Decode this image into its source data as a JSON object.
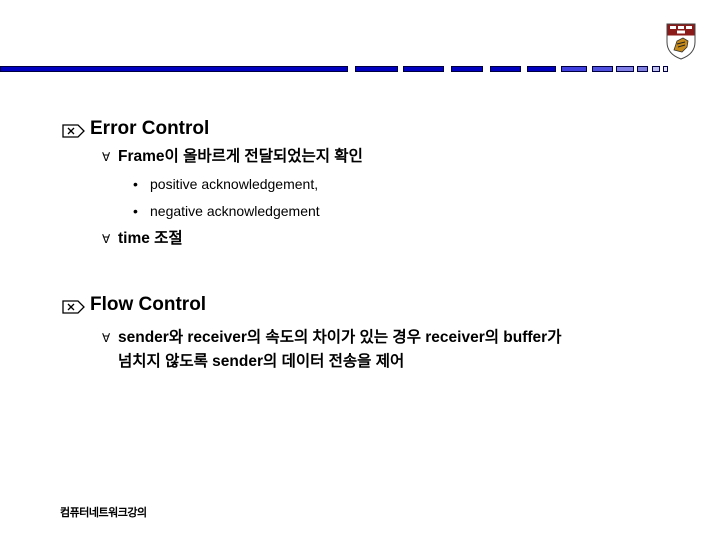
{
  "header": {
    "accent_color": "#0000c0",
    "logo": "university-crest-icon",
    "progress_segments": [
      {
        "color": "#0000c0"
      },
      {
        "color": "#0000c0"
      },
      {
        "color": "#0000c0"
      },
      {
        "color": "#0000c0"
      },
      {
        "color": "#0000c0"
      },
      {
        "color": "#0000c0"
      },
      {
        "color": "#4040e0"
      },
      {
        "color": "#5050e0"
      },
      {
        "color": "#8080e8"
      },
      {
        "color": "#8080e0"
      },
      {
        "color": "#c0c0f0"
      },
      {
        "color": "#e0e0f8"
      }
    ]
  },
  "content": {
    "sections": [
      {
        "icon": "box-x-arrow-icon",
        "title": "Error Control",
        "items": [
          {
            "icon": "check-icon",
            "text": "Frame이 올바르게 전달되었는지 확인",
            "subitems": [
              "positive acknowledgement,",
              "negative acknowledgement"
            ]
          },
          {
            "icon": "check-icon",
            "text": "time 조절"
          }
        ]
      },
      {
        "icon": "box-x-arrow-icon",
        "title": "Flow Control",
        "items": [
          {
            "icon": "check-icon",
            "text_line1": "sender와 receiver의 속도의 차이가 있는 경우 receiver의 buffer가",
            "text_line2": "넘치지 않도록 sender의 데이터 전송을 제어"
          }
        ]
      }
    ]
  },
  "footer": {
    "text": "컴퓨터네트워크강의"
  }
}
